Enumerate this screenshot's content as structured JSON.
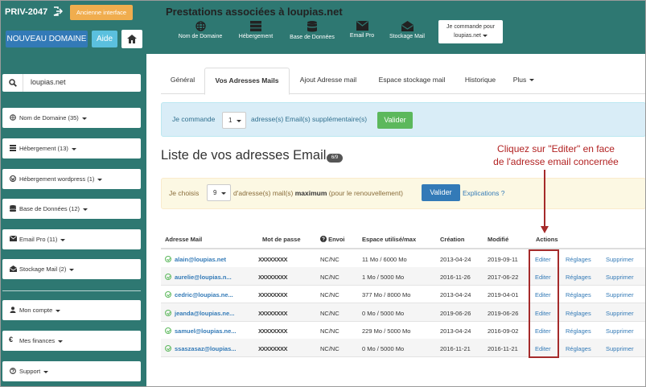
{
  "header": {
    "account_id": "PRIV-2047",
    "old_interface_label": "Ancienne interface",
    "new_domain_label": "NOUVEAU DOMAINE",
    "help_label": "Aide",
    "title": "Prestations associées à loupias.net",
    "services": [
      {
        "label": "Nom de Domaine",
        "icon": "globe-icon"
      },
      {
        "label": "Hébergement",
        "icon": "server-icon"
      },
      {
        "label": "Base de Données",
        "icon": "database-icon"
      },
      {
        "label": "Email Pro",
        "icon": "envelope-icon"
      },
      {
        "label": "Stockage Mail",
        "icon": "envelope-open-icon"
      }
    ],
    "order_line1": "Je commande pour",
    "order_line2": "loupias.net"
  },
  "sidebar": {
    "search_value": "loupias.net",
    "items": [
      {
        "label": "Nom de Domaine (35)",
        "icon": "globe-icon"
      },
      {
        "label": "Hébergement (13)",
        "icon": "server-icon"
      },
      {
        "label": "Hébergement wordpress (1)",
        "icon": "wordpress-icon"
      },
      {
        "label": "Base de Données (12)",
        "icon": "database-icon"
      },
      {
        "label": "Email Pro (11)",
        "icon": "envelope-icon"
      },
      {
        "label": "Stockage Mail (2)",
        "icon": "envelope-open-icon"
      },
      {
        "label": "Mon compte",
        "icon": "user-icon"
      },
      {
        "label": "Mes finances",
        "icon": "euro-icon"
      },
      {
        "label": "Support",
        "icon": "question-icon"
      }
    ]
  },
  "tabs": [
    "Général",
    "Vos Adresses Mails",
    "Ajout Adresse mail",
    "Espace stockage mail",
    "Historique",
    "Plus"
  ],
  "order_banner": {
    "prefix": "Je commande",
    "qty": "1",
    "suffix": "adresse(s) Email(s) supplémentaire(s)",
    "button": "Valider"
  },
  "list": {
    "title": "Liste de vos adresses Email",
    "count": "6/9"
  },
  "choice_banner": {
    "prefix": "Je choisis",
    "qty": "9",
    "text_a": "d'adresse(s) mail(s)",
    "text_bold": "maximum",
    "text_b": "(pour le renouvellement)",
    "button": "Valider",
    "link": "Explications ?"
  },
  "table": {
    "headers": [
      "Adresse Mail",
      "Mot de passe",
      "Envoi",
      "Espace utilisé/max",
      "Création",
      "Modifié",
      "Actions"
    ],
    "rows": [
      {
        "email": "alain@loupias.net",
        "password": "XXXXXXXX",
        "envoi": "NC/NC",
        "space": "11 Mo / 6000 Mo",
        "created": "2013-04-24",
        "modified": "2019-09-11",
        "a1": "Editer",
        "a2": "Réglages",
        "a3": "Supprimer"
      },
      {
        "email": "aurelie@loupias.n...",
        "password": "XXXXXXXX",
        "envoi": "NC/NC",
        "space": "1 Mo / 5000 Mo",
        "created": "2016-11-26",
        "modified": "2017-06-22",
        "a1": "Editer",
        "a2": "Réglages",
        "a3": "Supprimer"
      },
      {
        "email": "cedric@loupias.ne...",
        "password": "XXXXXXXX",
        "envoi": "NC/NC",
        "space": "377 Mo / 8000 Mo",
        "created": "2013-04-24",
        "modified": "2019-04-01",
        "a1": "Editer",
        "a2": "Réglages",
        "a3": "Supprimer"
      },
      {
        "email": "jeanda@loupias.ne...",
        "password": "XXXXXXXX",
        "envoi": "NC/NC",
        "space": "0 Mo / 5000 Mo",
        "created": "2019-06-26",
        "modified": "2019-06-26",
        "a1": "Editer",
        "a2": "Réglages",
        "a3": "Supprimer"
      },
      {
        "email": "samuel@loupias.ne...",
        "password": "XXXXXXXX",
        "envoi": "NC/NC",
        "space": "229 Mo / 5000 Mo",
        "created": "2013-04-24",
        "modified": "2016-09-02",
        "a1": "Editer",
        "a2": "Réglages",
        "a3": "Supprimer"
      },
      {
        "email": "ssaszasaz@loupias...",
        "password": "XXXXXXXX",
        "envoi": "NC/NC",
        "space": "0 Mo / 5000 Mo",
        "created": "2016-11-21",
        "modified": "2016-11-21",
        "a1": "Editer",
        "a2": "Réglages",
        "a3": "Supprimer"
      }
    ]
  },
  "annotation": {
    "line1": "Cliquez sur \"Editer\" en face",
    "line2": "de l'adresse email concernée"
  },
  "colors": {
    "teal": "#2e7872",
    "primary": "#337ab7",
    "success": "#5cb85c",
    "warning": "#f0ad4e",
    "annotation": "#a52a2a"
  }
}
